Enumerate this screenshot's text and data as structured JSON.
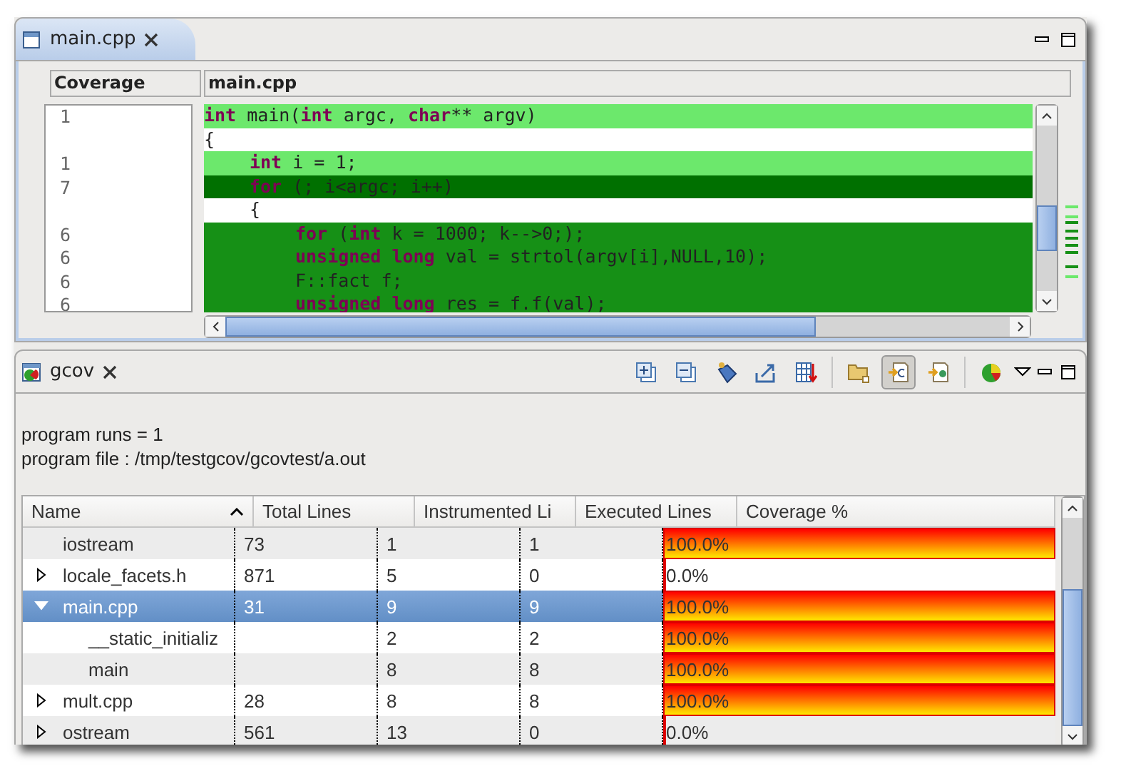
{
  "editor": {
    "tab": {
      "label": "main.cpp",
      "selected": true
    },
    "columns": [
      "Coverage",
      "main.cpp"
    ],
    "lines": [
      {
        "count": "1",
        "kind": "light",
        "segments": [
          {
            "t": "int",
            "kw": true
          },
          {
            "t": " main(",
            "kw": false
          },
          {
            "t": "int",
            "kw": true
          },
          {
            "t": " argc, ",
            "kw": false
          },
          {
            "t": "char",
            "kw": true
          },
          {
            "t": "** argv)",
            "kw": false
          }
        ]
      },
      {
        "kind": "none",
        "segments": [
          {
            "t": "{",
            "kw": false
          }
        ],
        "children": [
          {
            "count": "1",
            "kind": "light",
            "segments": [
              {
                "t": "int",
                "kw": true
              },
              {
                "t": " i = 1;",
                "kw": false
              }
            ]
          },
          {
            "count": "7",
            "kind": "dark",
            "segments": [
              {
                "t": "for",
                "kw": true
              },
              {
                "t": " (; i<argc; i++)",
                "kw": false
              }
            ]
          },
          {
            "kind": "none",
            "segments": [
              {
                "t": "{",
                "kw": false
              }
            ],
            "children": [
              {
                "count": "6",
                "kind": "mid",
                "segments": [
                  {
                    "t": "for",
                    "kw": true
                  },
                  {
                    "t": " (",
                    "kw": false
                  },
                  {
                    "t": "int",
                    "kw": true
                  },
                  {
                    "t": " k = 1000; k-->0;);",
                    "kw": false
                  }
                ]
              },
              {
                "count": "6",
                "kind": "mid",
                "segments": [
                  {
                    "t": "unsigned long",
                    "kw": true
                  },
                  {
                    "t": " val = strtol(argv[i],NULL,10);",
                    "kw": false
                  }
                ]
              },
              {
                "count": "6",
                "kind": "mid",
                "segments": [
                  {
                    "t": "F::fact f;",
                    "kw": false
                  }
                ]
              },
              {
                "count": "6",
                "kind": "mid",
                "segments": [
                  {
                    "t": "unsigned long",
                    "kw": true
                  },
                  {
                    "t": " res = f.f(val);",
                    "kw": false
                  }
                ]
              }
            ]
          }
        ]
      }
    ]
  },
  "gcov": {
    "tab": {
      "label": "gcov",
      "selected": false
    },
    "toolbar": [
      {
        "kind": "expand",
        "selected": false
      },
      {
        "kind": "collapse",
        "selected": false
      },
      {
        "kind": "tag",
        "selected": false
      },
      {
        "kind": "export",
        "selected": false
      },
      {
        "kind": "table",
        "selected": false
      },
      {
        "kind": "folder",
        "selected": false
      },
      {
        "kind": "file-c",
        "selected": true
      },
      {
        "kind": "file-dot",
        "selected": false
      },
      {
        "kind": "pie",
        "selected": false
      }
    ],
    "info": [
      "program runs = 1",
      "program file : /tmp/testgcov/gcovtest/a.out"
    ],
    "table": {
      "columns": [
        "Name",
        "Total Lines",
        "Instrumented Li",
        "Executed Lines",
        "Coverage %"
      ],
      "rows": [
        {
          "name": "iostream",
          "total": "73",
          "instrumented": "1",
          "executed": "1",
          "coverage": "100.0%",
          "level": 1,
          "selected": false
        },
        {
          "name": "locale_facets.h",
          "total": "871",
          "instrumented": "5",
          "executed": "0",
          "coverage": "0.0%",
          "level": 0,
          "selected": false,
          "expanded": false
        },
        {
          "name": "main.cpp",
          "total": "31",
          "instrumented": "9",
          "executed": "9",
          "coverage": "100.0%",
          "level": 1,
          "selected": true,
          "expanded": true,
          "children": [
            {
              "name": "__static_initializ",
              "instrumented": "2",
              "executed": "2",
              "coverage": "100.0%",
              "level": 1,
              "selected": false
            },
            {
              "name": "main",
              "instrumented": "8",
              "executed": "8",
              "coverage": "100.0%",
              "level": 1,
              "selected": false
            }
          ]
        },
        {
          "name": "mult.cpp",
          "total": "28",
          "instrumented": "8",
          "executed": "8",
          "coverage": "100.0%",
          "level": 1,
          "selected": false,
          "expanded": false
        },
        {
          "name": "ostream",
          "total": "561",
          "instrumented": "13",
          "executed": "0",
          "coverage": "0.0%",
          "level": 0,
          "selected": false,
          "expanded": false
        }
      ]
    }
  }
}
